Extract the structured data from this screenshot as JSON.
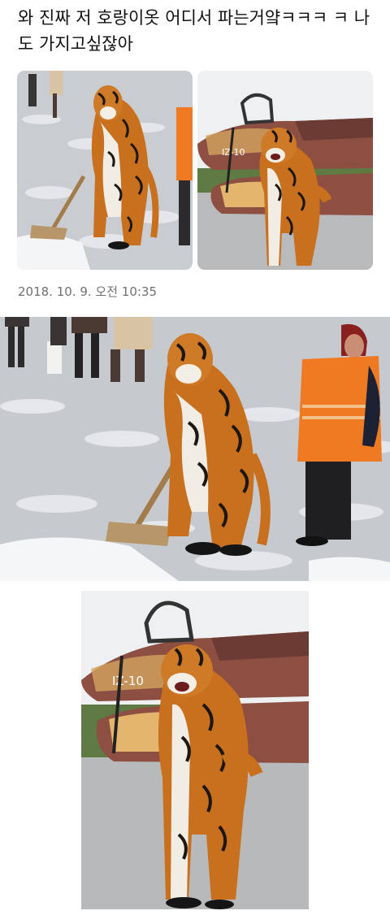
{
  "tweet": {
    "text": "와 진짜 저 호랑이옷 어디서 파는거얔ㅋㅋㅋ ㅋ 나도 가지고싶잖아",
    "timestamp": "2018. 10. 9. 오전 10:35"
  },
  "photos": [
    {
      "icon": "tiger-costume-shoveling-snow-photo"
    },
    {
      "icon": "tiger-costume-by-jet-photo"
    },
    {
      "icon": "tiger-costume-shoveling-snow-large-photo"
    },
    {
      "icon": "tiger-costume-by-jet-large-photo"
    }
  ],
  "aircraft_code": "IZ-10",
  "colors": {
    "text": "#111111",
    "timestamp": "#707070",
    "snow": "#dfe1e4",
    "tiger_orange": "#c8701e",
    "vest_orange": "#f07a22",
    "jet_brown": "#8c4f42"
  }
}
